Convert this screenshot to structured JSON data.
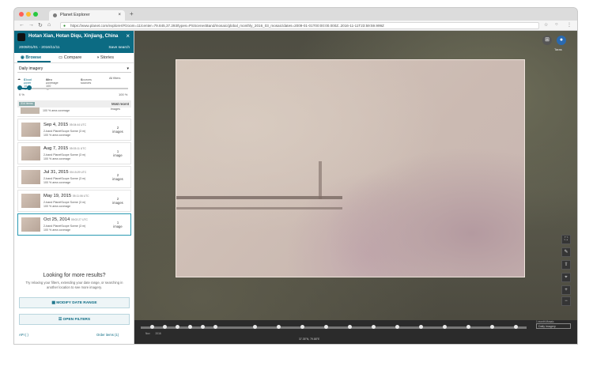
{
  "browser": {
    "tab_title": "Planet Explorer",
    "tab_close": "×",
    "new_tab": "+",
    "url": "https://www.planet.com/explorer/#/zoom=11/center=79.845,37.293/types=PSScene4Band/mosaic/global_monthly_2016_03_mosaic/dates=2009-01-01T00:00:00.000Z..2016-11-11T23:59:59.999Z",
    "colors": {
      "close": "#ff5f57",
      "minimize": "#febc2e",
      "maximize": "#28c840"
    }
  },
  "sidebar": {
    "location": "Hotan Xian, Hotan Diqu, Xinjiang, China",
    "close": "×",
    "date_range": "2009/01/01 - 2016/11/11",
    "save_search": "Save search",
    "tabs": [
      {
        "label": "Browse",
        "icon": "eye-icon"
      },
      {
        "label": "Compare",
        "icon": "compare-icon"
      },
      {
        "label": "Stories",
        "icon": "stories-icon"
      }
    ],
    "imagery_select": "Daily imagery",
    "filters": {
      "cloud_cover": "Cloud cover",
      "cloud_value": "0 - 10 %",
      "area_coverage": "Area coverage",
      "area_value": "90 - 100 %",
      "sources": "Sources",
      "sources_value": "4 sources",
      "all_filters": "All filters"
    },
    "slider_left": "0 %",
    "slider_right": "100 %",
    "list_badge": "314 items",
    "sort": "Most recent",
    "partial_item": {
      "text": "100 % area coverage",
      "count": "images"
    },
    "cards": [
      {
        "date": "Sep 4, 2015",
        "time": "05:04:44 UTC",
        "source": "2-band PlanetScope Scene (3 m)",
        "coverage": "100 % area coverage",
        "count": "2",
        "unit": "images"
      },
      {
        "date": "Aug 7, 2015",
        "time": "05:03:11 UTC",
        "source": "2-band PlanetScope Scene (3 m)",
        "coverage": "100 % area coverage",
        "count": "1",
        "unit": "image"
      },
      {
        "date": "Jul 31, 2015",
        "time": "05:15:29 UTC",
        "source": "2-band PlanetScope Scene (3 m)",
        "coverage": "100 % area coverage",
        "count": "2",
        "unit": "images"
      },
      {
        "date": "May 19, 2015",
        "time": "05:11:06 UTC",
        "source": "2-band PlanetScope Scene (3 m)",
        "coverage": "100 % area coverage",
        "count": "2",
        "unit": "images"
      },
      {
        "date": "Oct 25, 2014",
        "time": "05:02:27 UTC",
        "source": "2-band PlanetScope Scene (3 m)",
        "coverage": "100 % area coverage",
        "count": "1",
        "unit": "image"
      }
    ],
    "more_title": "Looking for more results?",
    "more_text": "Try relaxing your filters, extending your date range, or searching in another location to see more imagery.",
    "modify_btn": "MODIFY DATE RANGE",
    "open_filters_btn": "OPEN FILTERS",
    "footer_left": "API ( )",
    "footer_right": "Order items (1)"
  },
  "map": {
    "user_label": "Taras",
    "timeline_label": "1 month Mosaic",
    "timeline_select": "Daily imagery",
    "timeline_months": "Nov 2016",
    "status": "37.35°N, 79.88°E"
  }
}
